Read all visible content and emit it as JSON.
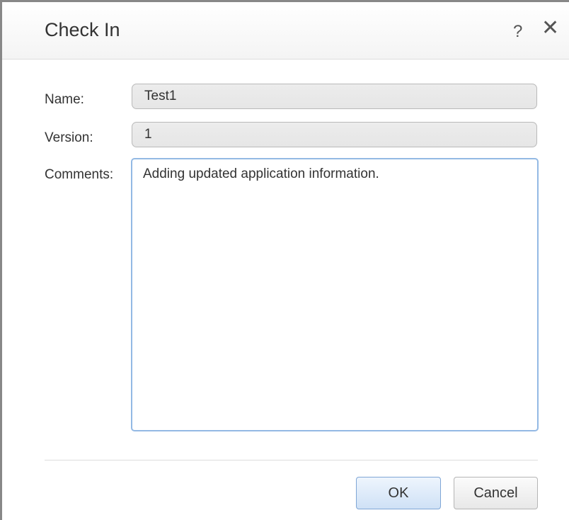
{
  "dialog": {
    "title": "Check In",
    "help_icon": "?",
    "close_icon": "✕"
  },
  "form": {
    "name_label": "Name:",
    "name_value": "Test1",
    "version_label": "Version:",
    "version_value": "1",
    "comments_label": "Comments:",
    "comments_value": "Adding updated application information."
  },
  "buttons": {
    "ok_label": "OK",
    "cancel_label": "Cancel"
  },
  "colors": {
    "focus_border": "#93b9e4",
    "primary_button_border": "#7fa6d6"
  },
  "icons": {
    "help": "help-icon",
    "close": "close-icon"
  }
}
